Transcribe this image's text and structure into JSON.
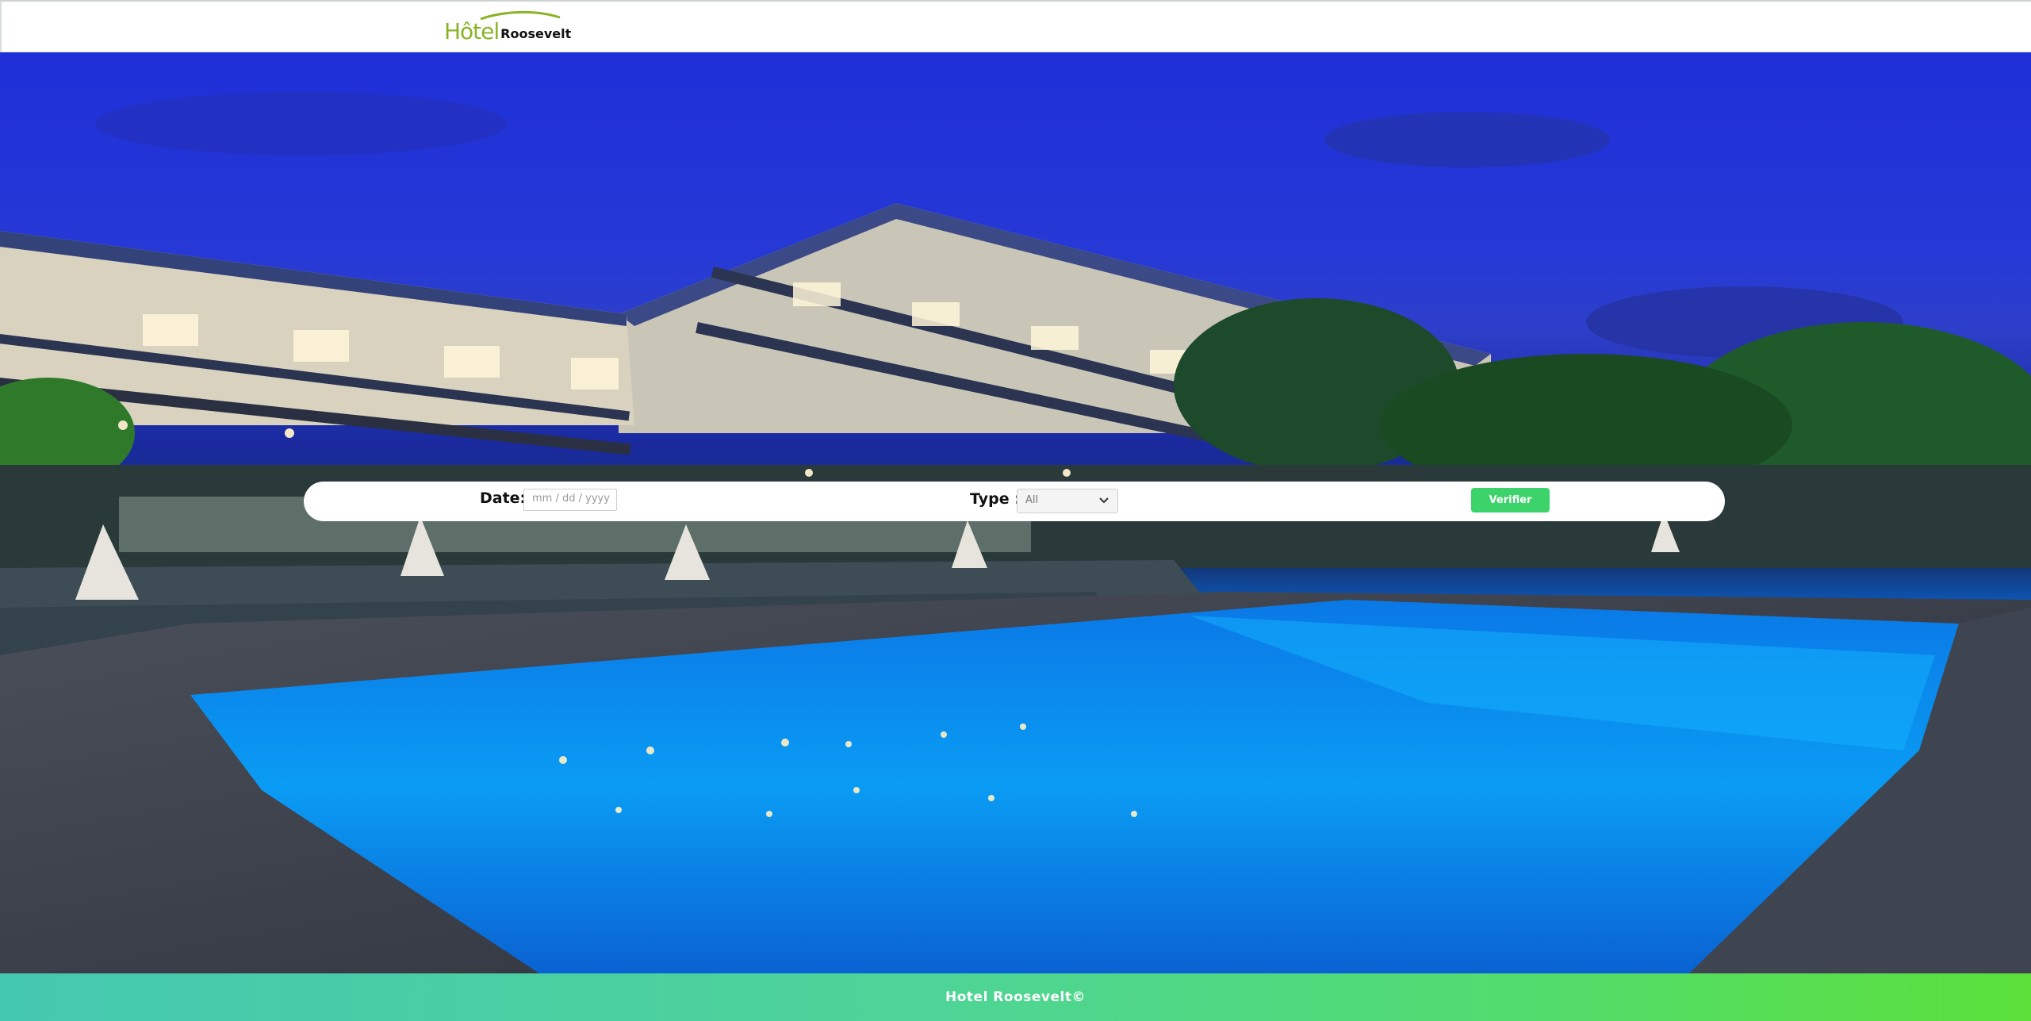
{
  "header": {
    "logo_hotel": "Hôtel",
    "logo_name": "Roosevelt"
  },
  "search": {
    "date_label": "Date:",
    "date_placeholder": "mm / dd / yyyy",
    "type_label": "Type :",
    "type_selected": "All",
    "verify_label": "Verifier"
  },
  "footer": {
    "text": "Hotel Roosevelt©"
  },
  "colors": {
    "accent_green": "#3cd36b",
    "logo_green": "#8ab428",
    "footer_gradient_start": "#45c8b0",
    "footer_gradient_end": "#5be03a"
  },
  "icons": {
    "select": "chevron-down-icon"
  }
}
